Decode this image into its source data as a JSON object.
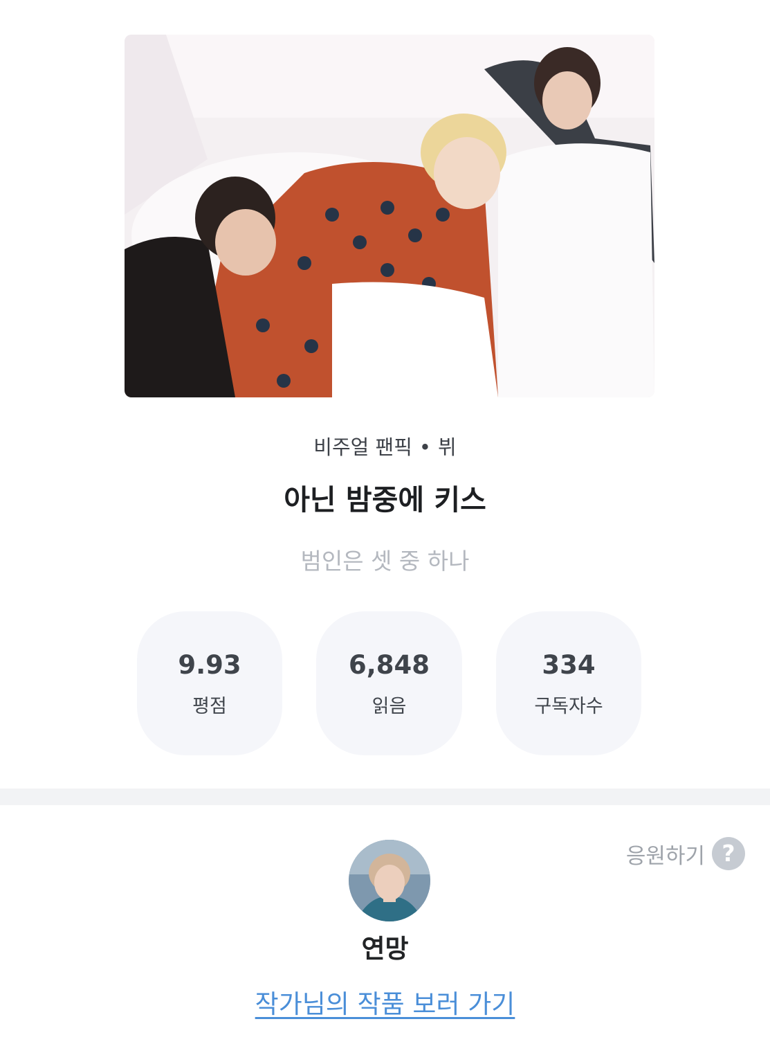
{
  "cover": {
    "image": "cover-photo-three-people-on-bed"
  },
  "info": {
    "category": "비주얼 팬픽",
    "separator": "•",
    "character": "뷔",
    "title": "아닌 밤중에 키스",
    "subtitle": "범인은 셋 중 하나"
  },
  "stats": [
    {
      "value": "9.93",
      "label": "평점"
    },
    {
      "value": "6,848",
      "label": "읽음"
    },
    {
      "value": "334",
      "label": "구독자수"
    }
  ],
  "author": {
    "cheer_label": "응원하기",
    "help_icon": "question-mark-icon",
    "help_glyph": "?",
    "avatar": "author-avatar",
    "name": "연망",
    "works_link": "작가님의 작품 보러 가기"
  },
  "colors": {
    "link": "#4a8ed8",
    "stat_bg": "#f5f6fa",
    "divider": "#f2f3f5",
    "subtitle": "#b4b8bf"
  }
}
